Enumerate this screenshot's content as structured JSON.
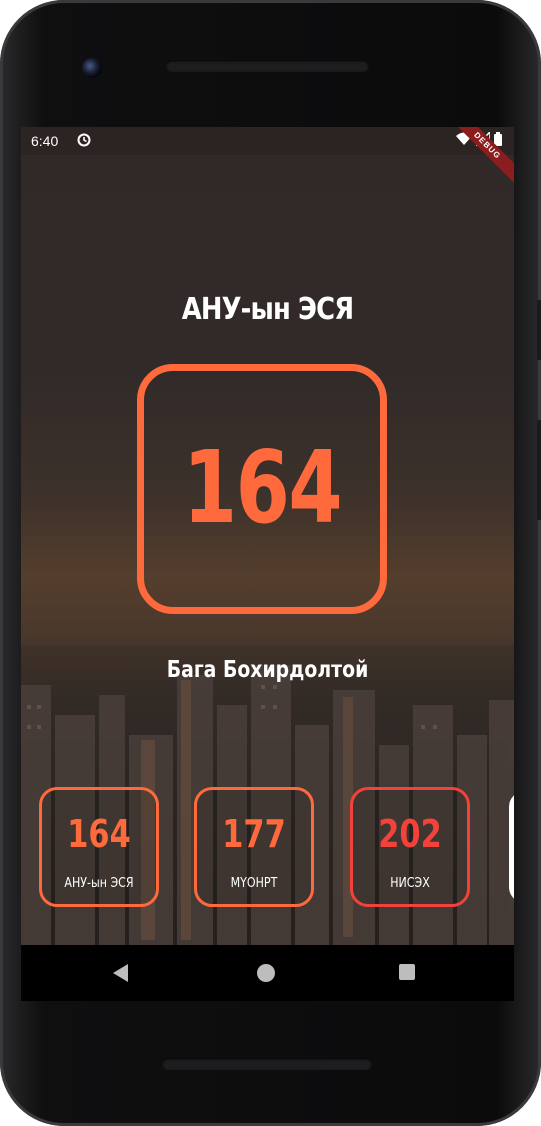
{
  "status_bar": {
    "time": "6:40",
    "debug_label": "DEBUG"
  },
  "main": {
    "title": "АНУ-ын ЭСЯ",
    "value": "164",
    "status": "Бага Бохирдолтой",
    "accent_color": "#ff6a3d"
  },
  "cards": [
    {
      "value": "164",
      "label": "АНУ-ын ЭСЯ",
      "color": "#ff6a3d"
    },
    {
      "value": "177",
      "label": "МҮОНРТ",
      "color": "#ff6a3d"
    },
    {
      "value": "202",
      "label": "НИСЭХ",
      "color": "#f2423a"
    }
  ],
  "nav": {
    "icons": [
      "back-icon",
      "home-icon",
      "recents-icon"
    ]
  }
}
